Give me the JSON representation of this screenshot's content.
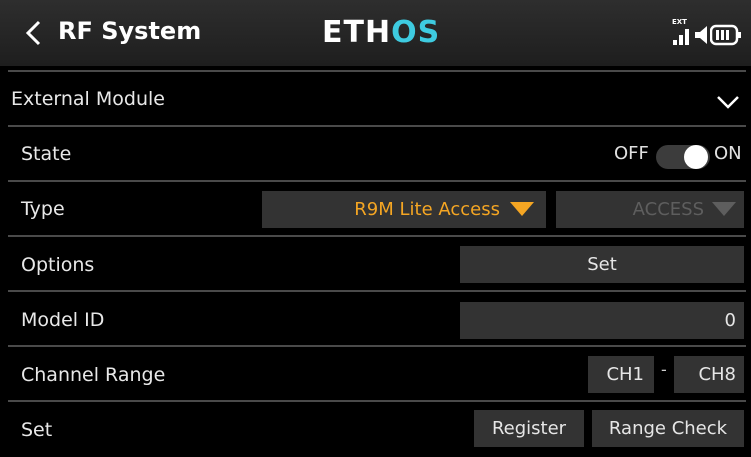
{
  "header": {
    "title": "RF System",
    "logo_primary": "ETH",
    "logo_accent": "OS",
    "ext_indicator": "EXT"
  },
  "section": {
    "label": "External Module"
  },
  "rows": {
    "state": {
      "label": "State",
      "off_text": "OFF",
      "on_text": "ON",
      "value": "ON"
    },
    "type": {
      "label": "Type",
      "module_value": "R9M Lite Access",
      "protocol_value": "ACCESS"
    },
    "options": {
      "label": "Options",
      "button_label": "Set"
    },
    "model_id": {
      "label": "Model ID",
      "value": "0"
    },
    "channel_range": {
      "label": "Channel Range",
      "start": "CH1",
      "separator": "-",
      "end": "CH8"
    },
    "set": {
      "label": "Set",
      "register_label": "Register",
      "range_check_label": "Range Check"
    }
  },
  "colors": {
    "accent": "#f5a623",
    "logo_accent": "#3ecbe0",
    "field_bg": "#333333",
    "disabled_text": "#5e5e5e"
  },
  "icons": [
    "back-icon",
    "signal-icon",
    "speaker-icon",
    "battery-icon",
    "chevron-down-icon",
    "dropdown-arrow-icon"
  ]
}
